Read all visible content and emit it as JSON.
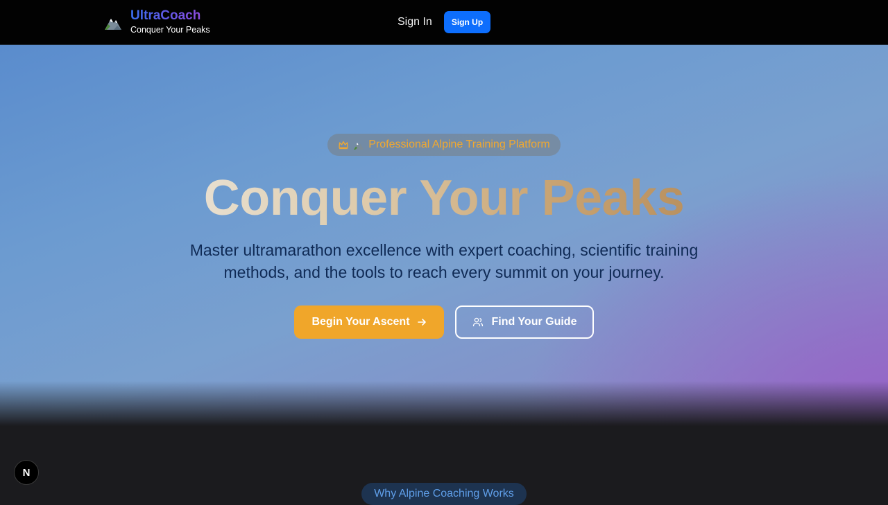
{
  "nav": {
    "brand_name": "UltraCoach",
    "brand_tagline": "Conquer Your Peaks",
    "brand_icon": "mountain-icon",
    "signin_label": "Sign In",
    "signup_label": "Sign Up",
    "signup_color": "#0d6efd"
  },
  "hero": {
    "badge_icons": [
      "crown-icon",
      "mountain-icon"
    ],
    "badge_label": "Professional Alpine Training Platform",
    "headline": "Conquer Your Peaks",
    "subtitle": "Master ultramarathon excellence with expert coaching, scientific training methods, and the tools to reach every summit on your journey.",
    "primary_cta": "Begin Your Ascent",
    "primary_cta_icon": "arrow-right-icon",
    "primary_color": "#f0a62a",
    "secondary_cta": "Find Your Guide",
    "secondary_cta_icon": "users-icon"
  },
  "next_section": {
    "badge_label": "Why Alpine Coaching Works"
  },
  "dev_badge": {
    "label": "N"
  }
}
